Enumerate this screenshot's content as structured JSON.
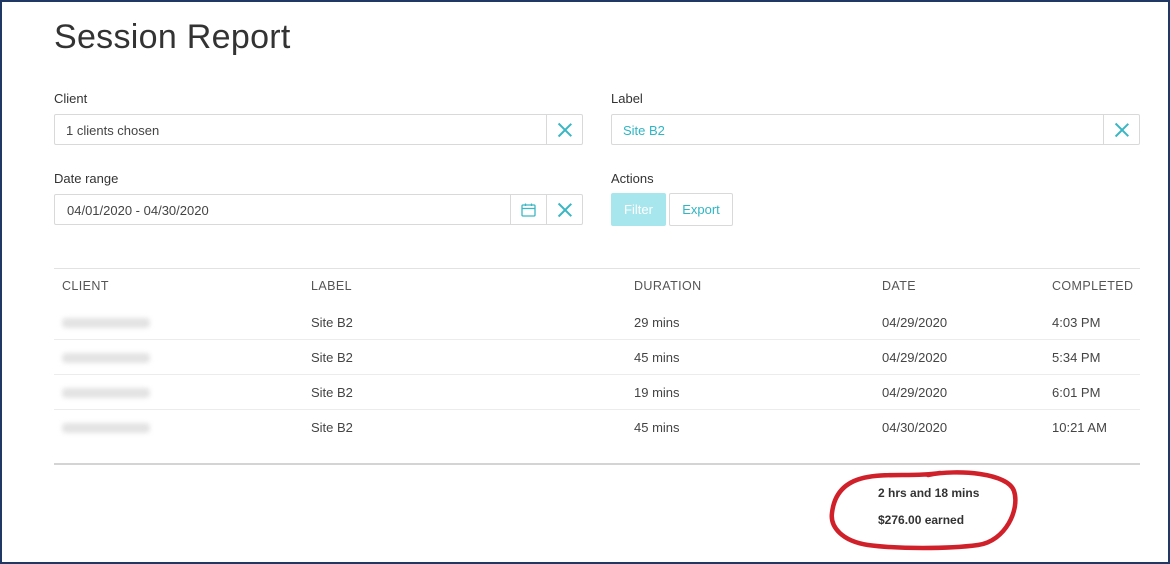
{
  "page": {
    "title": "Session Report"
  },
  "filters": {
    "client": {
      "label": "Client",
      "value": "1 clients chosen"
    },
    "label": {
      "label": "Label",
      "value": "Site B2"
    },
    "date_range": {
      "label": "Date range",
      "value": "04/01/2020 - 04/30/2020"
    },
    "actions": {
      "label": "Actions",
      "filter_button": "Filter",
      "export_button": "Export"
    }
  },
  "table": {
    "headers": [
      "CLIENT",
      "LABEL",
      "DURATION",
      "DATE",
      "COMPLETED"
    ],
    "rows": [
      {
        "label": "Site B2",
        "duration": "29 mins",
        "date": "04/29/2020",
        "completed": "4:03 PM"
      },
      {
        "label": "Site B2",
        "duration": "45 mins",
        "date": "04/29/2020",
        "completed": "5:34 PM"
      },
      {
        "label": "Site B2",
        "duration": "19 mins",
        "date": "04/29/2020",
        "completed": "6:01 PM"
      },
      {
        "label": "Site B2",
        "duration": "45 mins",
        "date": "04/30/2020",
        "completed": "10:21 AM"
      }
    ]
  },
  "summary": {
    "total_time": "2 hrs and 18 mins",
    "earned": "$276.00 earned"
  },
  "colors": {
    "accent": "#2fb5c4",
    "filter_button_bg": "#a8e6ee",
    "annotation": "#d0202a",
    "frame_border": "#1f3864"
  },
  "icons": {
    "clear": "close-icon",
    "calendar": "calendar-icon"
  }
}
